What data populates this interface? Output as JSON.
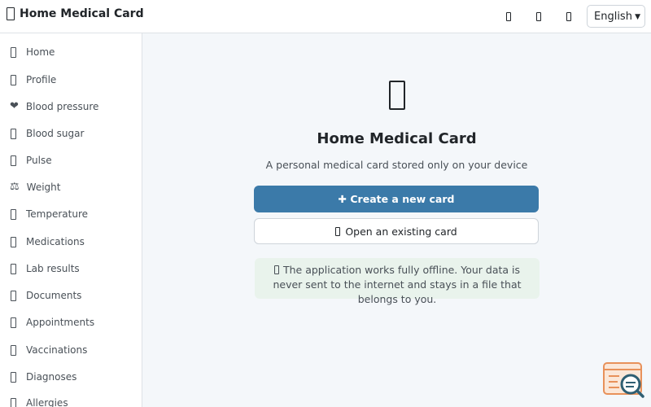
{
  "header": {
    "title": "Home Medical Card",
    "icons": [
      "header-action-1-icon",
      "header-action-2-icon",
      "header-action-3-icon"
    ],
    "language": {
      "selected": "English"
    }
  },
  "sidebar": {
    "items": [
      {
        "label": "Home",
        "icon": "box"
      },
      {
        "label": "Profile",
        "icon": "box"
      },
      {
        "label": "Blood pressure",
        "icon": "heart",
        "glyph": "❤"
      },
      {
        "label": "Blood sugar",
        "icon": "box"
      },
      {
        "label": "Pulse",
        "icon": "box"
      },
      {
        "label": "Weight",
        "icon": "scales",
        "glyph": "⚖"
      },
      {
        "label": "Temperature",
        "icon": "box"
      },
      {
        "label": "Medications",
        "icon": "box"
      },
      {
        "label": "Lab results",
        "icon": "box"
      },
      {
        "label": "Documents",
        "icon": "box"
      },
      {
        "label": "Appointments",
        "icon": "box"
      },
      {
        "label": "Vaccinations",
        "icon": "box"
      },
      {
        "label": "Diagnoses",
        "icon": "box"
      },
      {
        "label": "Allergies",
        "icon": "box"
      }
    ]
  },
  "main": {
    "title": "Home Medical Card",
    "subtitle": "A personal medical card stored only on your device",
    "create_button": "✚ Create a new card",
    "open_button": "Open an existing card",
    "info_text": "The application works fully offline. Your data is never sent to the internet and stays in a file that belongs to you."
  },
  "colors": {
    "primary": "#3b7aa9",
    "info_bg": "#e9f3ec",
    "badge_orange": "#e8915a",
    "badge_teal": "#2f5f73"
  }
}
